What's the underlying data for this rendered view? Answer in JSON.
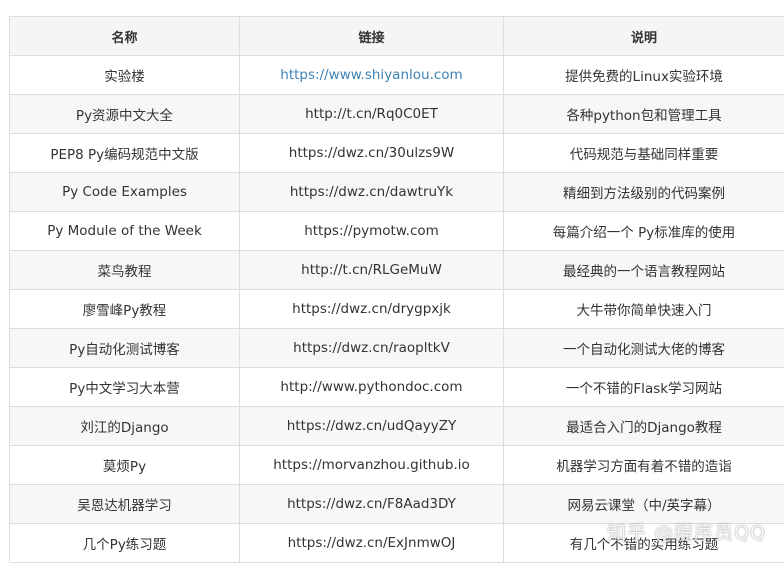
{
  "table": {
    "headers": [
      "名称",
      "链接",
      "说明"
    ],
    "rows": [
      {
        "name": "实验楼",
        "link": "https://www.shiyanlou.com",
        "desc": "提供免费的Linux实验环境",
        "link_color": "#3d83b6"
      },
      {
        "name": "Py资源中文大全",
        "link": "http://t.cn/Rq0C0ET",
        "desc": "各种python包和管理工具"
      },
      {
        "name": "PEP8 Py编码规范中文版",
        "link": "https://dwz.cn/30ulzs9W",
        "desc": "代码规范与基础同样重要"
      },
      {
        "name": "Py Code Examples",
        "link": "https://dwz.cn/dawtruYk",
        "desc": "精细到方法级别的代码案例"
      },
      {
        "name": "Py Module of the Week",
        "link": "https://pymotw.com",
        "desc": "每篇介绍一个 Py标准库的使用"
      },
      {
        "name": "菜鸟教程",
        "link": "http://t.cn/RLGeMuW",
        "desc": "最经典的一个语言教程网站"
      },
      {
        "name": "廖雪峰Py教程",
        "link": "https://dwz.cn/drygpxjk",
        "desc": "大牛带你简单快速入门"
      },
      {
        "name": "Py自动化测试博客",
        "link": "https://dwz.cn/raopltkV",
        "desc": "一个自动化测试大佬的博客"
      },
      {
        "name": "Py中文学习大本营",
        "link": "http://www.pythondoc.com",
        "desc": "一个不错的Flask学习网站"
      },
      {
        "name": "刘江的Django",
        "link": "https://dwz.cn/udQayyZY",
        "desc": "最适合入门的Django教程"
      },
      {
        "name": "莫烦Py",
        "link": "https://morvanzhou.github.io",
        "desc": "机器学习方面有着不错的造诣"
      },
      {
        "name": "吴恩达机器学习",
        "link": "https://dwz.cn/F8Aad3DY",
        "desc": "网易云课堂（中/英字幕）"
      },
      {
        "name": "几个Py练习题",
        "link": "https://dwz.cn/ExJnmwOJ",
        "desc": "有几个不错的实用练习题"
      }
    ]
  },
  "watermark": "知乎 @程序员QQ",
  "colors": {
    "header_bg": "#f5f5f5",
    "stripe_bg": "#f7f7f7",
    "border": "#dddddd",
    "link_accent": "#3d83b6"
  }
}
